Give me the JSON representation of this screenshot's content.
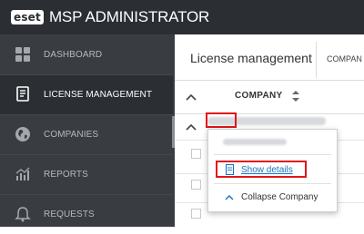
{
  "app": {
    "logo_text": "eset",
    "title": "MSP ADMINISTRATOR"
  },
  "sidebar": {
    "items": [
      {
        "label": "DASHBOARD",
        "icon": "dashboard-icon",
        "active": false
      },
      {
        "label": "LICENSE MANAGEMENT",
        "icon": "license-icon",
        "active": true
      },
      {
        "label": "COMPANIES",
        "icon": "globe-icon",
        "active": false
      },
      {
        "label": "REPORTS",
        "icon": "reports-icon",
        "active": false
      },
      {
        "label": "REQUESTS",
        "icon": "requests-icon",
        "active": false
      }
    ]
  },
  "main": {
    "title": "License management",
    "tab_partial": "COMPAN",
    "table": {
      "column_header": "COMPANY"
    }
  },
  "context_menu": {
    "show_details": "Show details",
    "collapse": "Collapse Company"
  },
  "colors": {
    "topbar": "#2b2f33",
    "sidebar": "#393d42",
    "highlight": "#e0161b",
    "link": "#1a73c0"
  }
}
